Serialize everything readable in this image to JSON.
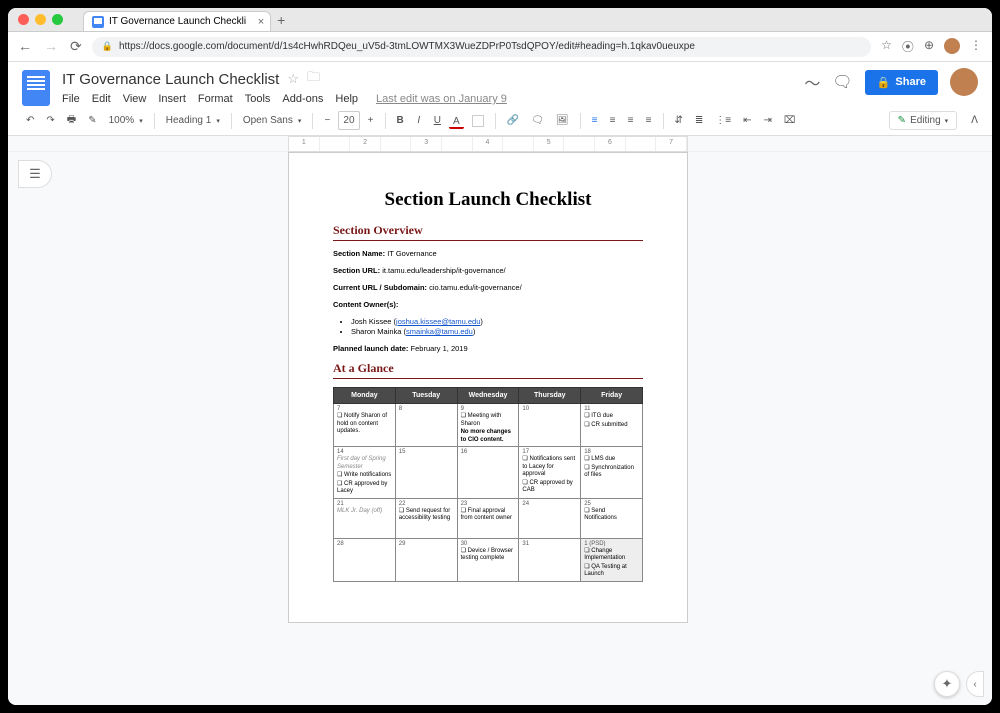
{
  "browser": {
    "tab_title": "IT Governance Launch Checkli",
    "url": "https://docs.google.com/document/d/1s4cHwhRDQeu_uV5d-3tmLOWTMX3WueZDPrP0TsdQPOY/edit#heading=h.1qkav0ueuxpe",
    "star_tooltip": "☆"
  },
  "docs": {
    "title": "IT Governance Launch Checklist",
    "menus": [
      "File",
      "Edit",
      "View",
      "Insert",
      "Format",
      "Tools",
      "Add-ons",
      "Help"
    ],
    "last_edit": "Last edit was on January 9",
    "share_label": "Share"
  },
  "toolbar": {
    "zoom": "100%",
    "style": "Heading 1",
    "font": "Open Sans",
    "size": "20",
    "editing": "Editing"
  },
  "ruler": {
    "marks": [
      "1",
      "",
      "2",
      "",
      "3",
      "",
      "4",
      "",
      "5",
      "",
      "6",
      "",
      "7"
    ]
  },
  "document": {
    "title": "Section Launch Checklist",
    "overview_heading": "Section Overview",
    "glance_heading": "At a Glance",
    "section_name_label": "Section Name:",
    "section_name_value": "IT Governance",
    "section_url_label": "Section URL:",
    "section_url_value": "it.tamu.edu/leadership/it-governance/",
    "current_url_label": "Current URL / Subdomain:",
    "current_url_value": "cio.tamu.edu/it-governance/",
    "owners_label": "Content Owner(s):",
    "owners": [
      {
        "name": "Josh Kissee",
        "email": "joshua.kissee@tamu.edu"
      },
      {
        "name": "Sharon Mainka",
        "email": "smainka@tamu.edu"
      }
    ],
    "launch_label": "Planned launch date:",
    "launch_value": "February 1, 2019",
    "calendar": {
      "headers": [
        "Monday",
        "Tuesday",
        "Wednesday",
        "Thursday",
        "Friday"
      ],
      "rows": [
        [
          {
            "day": "7",
            "items": [
              "Notify Sharon of hold on content updates."
            ]
          },
          {
            "day": "8",
            "items": []
          },
          {
            "day": "9",
            "items": [
              "Meeting with Sharon"
            ],
            "note": "No more changes to CIO content."
          },
          {
            "day": "10",
            "items": []
          },
          {
            "day": "11",
            "items": [
              "ITG due",
              "CR submitted"
            ]
          }
        ],
        [
          {
            "day": "14",
            "sub": "First day of Spring Semester",
            "items": [
              "Write notifications",
              "CR approved by Lacey"
            ]
          },
          {
            "day": "15",
            "items": []
          },
          {
            "day": "16",
            "items": []
          },
          {
            "day": "17",
            "items": [
              "Notifications sent to Lacey for approval",
              "CR approved by CAB"
            ]
          },
          {
            "day": "18",
            "items": [
              "LMS due",
              "Synchronization of files"
            ]
          }
        ],
        [
          {
            "day": "21",
            "sub": "MLK Jr. Day (off)",
            "items": []
          },
          {
            "day": "22",
            "items": [
              "Send request for accessibility testing"
            ]
          },
          {
            "day": "23",
            "items": [
              "Final approval from content owner"
            ]
          },
          {
            "day": "24",
            "items": []
          },
          {
            "day": "25",
            "items": [
              "Send Notifications"
            ]
          }
        ],
        [
          {
            "day": "28",
            "items": []
          },
          {
            "day": "29",
            "items": []
          },
          {
            "day": "30",
            "items": [
              "Device / Browser testing complete"
            ]
          },
          {
            "day": "31",
            "items": []
          },
          {
            "day": "1 (PSD)",
            "gray": true,
            "items": [
              "Change Implementation",
              "QA Testing at Launch"
            ]
          }
        ]
      ]
    }
  }
}
